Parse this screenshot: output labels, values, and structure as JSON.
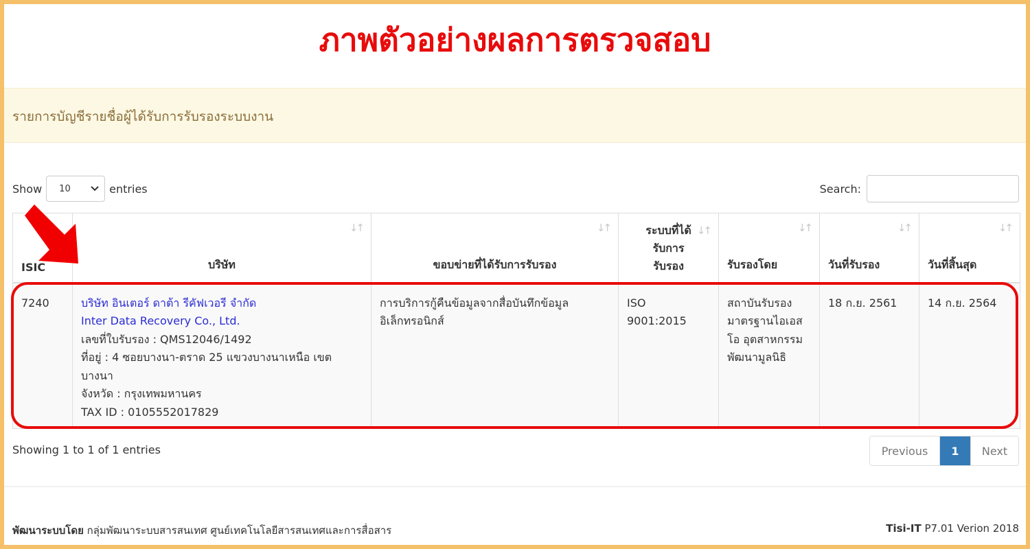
{
  "banner": {
    "title": "ภาพตัวอย่างผลการตรวจสอบ"
  },
  "panel": {
    "heading": "รายการบัญชีรายชื่อผู้ได้รับการรับรองระบบงาน"
  },
  "length_control": {
    "show_label": "Show",
    "selected_value": "10",
    "entries_label": "entries"
  },
  "search": {
    "label": "Search:",
    "value": ""
  },
  "table": {
    "headers": {
      "isic": "ISIC",
      "company": "บริษัท",
      "scope": "ขอบข่ายที่ได้รับการรับรอง",
      "system_line1": "ระบบที่ได้",
      "system_line2": "รับการ",
      "system_line3": "รับรอง",
      "certified_by": "รับรองโดย",
      "start_date": "วันที่รับรอง",
      "end_date": "วันที่สิ้นสุด"
    },
    "sort_icon": "sort-icon",
    "rows": [
      {
        "isic": "7240",
        "company_th": "บริษัท อินเตอร์ ดาต้า รีคัฟเวอรี จำกัด",
        "company_en": "Inter Data Recovery Co., Ltd.",
        "cert_no": "เลขที่ใบรับรอง : QMS12046/1492",
        "address": "ที่อยู่ : 4 ซอยบางนา-ตราด 25 แขวงบางนาเหนือ เขตบางนา",
        "province": "จังหวัด : กรุงเทพมหานคร",
        "tax_id": "TAX ID : 0105552017829",
        "scope": "การบริการกู้คืนข้อมูลจากสื่อบันทึกข้อมูลอิเล็กทรอนิกส์",
        "system_line1": "ISO",
        "system_line2": "9001:2015",
        "certified_by": "สถาบันรับรองมาตรฐานไอเอสโอ อุตสาหกรรมพัฒนามูลนิธิ",
        "start_date": "18 ก.ย. 2561",
        "end_date": "14 ก.ย. 2564"
      }
    ]
  },
  "pagination": {
    "info": "Showing 1 to 1 of 1 entries",
    "previous": "Previous",
    "current": "1",
    "next": "Next"
  },
  "footer": {
    "dev_label": "พัฒนาระบบโดย",
    "dev_org": " กลุ่มพัฒนาระบบสารสนเทศ ศูนย์เทคโนโลยีสารสนเทศและการสื่อสาร",
    "brand": "Tisi-IT",
    "version": " P7.01 Verion 2018"
  },
  "colors": {
    "banner_title": "#e80b0b",
    "frame": "#f5c06a",
    "panel_bg": "#fcf8e3",
    "panel_text": "#8a6d3b",
    "page_active": "#337ab7",
    "link": "#2b2bd6"
  }
}
